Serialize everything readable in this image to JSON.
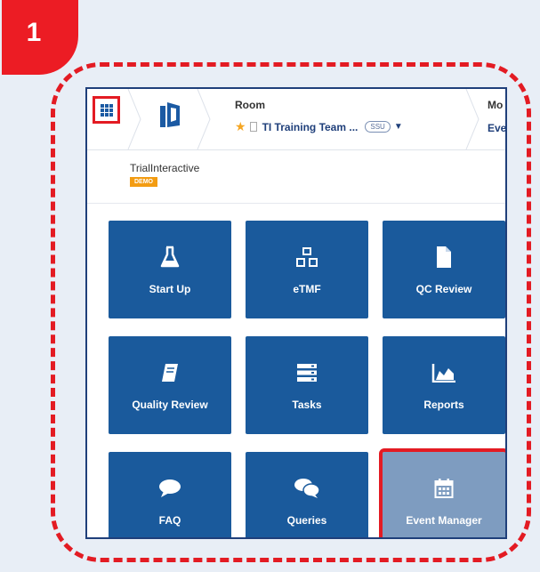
{
  "step": {
    "number": "1"
  },
  "header": {
    "room_label": "Room",
    "room_name": "TI Training Team ...",
    "room_badge": "SSU",
    "module_label": "Mo",
    "module_value": "Eve"
  },
  "brand": {
    "name": "TrialInteractive",
    "badge": "DEMO"
  },
  "tiles": [
    {
      "label": "Start Up",
      "icon": "flask-icon"
    },
    {
      "label": "eTMF",
      "icon": "cubes-icon"
    },
    {
      "label": "QC Review",
      "icon": "document-icon"
    },
    {
      "label": "Quality Review",
      "icon": "book-icon"
    },
    {
      "label": "Tasks",
      "icon": "server-icon"
    },
    {
      "label": "Reports",
      "icon": "area-chart-icon"
    },
    {
      "label": "FAQ",
      "icon": "speech-bubble-icon"
    },
    {
      "label": "Queries",
      "icon": "chat-bubbles-icon"
    },
    {
      "label": "Event Manager",
      "icon": "calendar-icon"
    }
  ],
  "colors": {
    "accent": "#e31b23",
    "tile": "#1a5a9c",
    "tile_disabled": "#7e9cc0"
  }
}
